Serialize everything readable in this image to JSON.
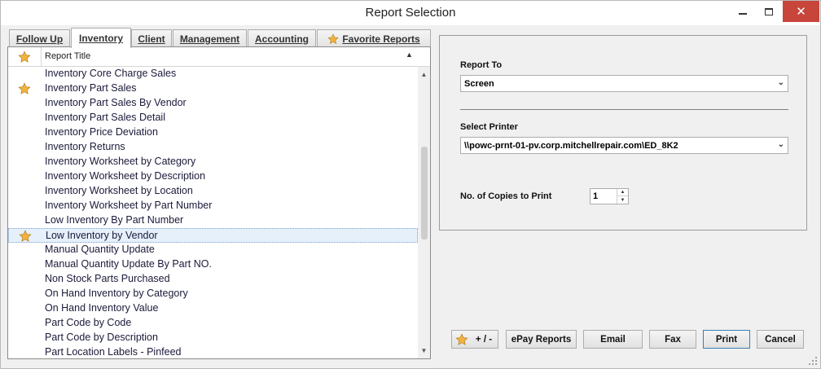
{
  "window": {
    "title": "Report Selection",
    "minimize_label": "",
    "maximize_label": "",
    "close_label": "✕"
  },
  "tabs": [
    {
      "label": "Follow Up"
    },
    {
      "label": "Inventory"
    },
    {
      "label": "Client"
    },
    {
      "label": "Management"
    },
    {
      "label": "Accounting"
    },
    {
      "label": "Favorite Reports",
      "icon": "star-icon"
    }
  ],
  "report_list": {
    "column_title": "Report Title",
    "sort": "ascending",
    "rows": [
      {
        "title": "Inventory Core Charge Sales",
        "favorite": false
      },
      {
        "title": "Inventory Part Sales",
        "favorite": true
      },
      {
        "title": "Inventory Part Sales By Vendor",
        "favorite": false
      },
      {
        "title": "Inventory Part Sales Detail",
        "favorite": false
      },
      {
        "title": "Inventory Price Deviation",
        "favorite": false
      },
      {
        "title": "Inventory Returns",
        "favorite": false
      },
      {
        "title": "Inventory Worksheet by Category",
        "favorite": false
      },
      {
        "title": "Inventory Worksheet by Description",
        "favorite": false
      },
      {
        "title": "Inventory Worksheet by Location",
        "favorite": false
      },
      {
        "title": "Inventory Worksheet by Part Number",
        "favorite": false
      },
      {
        "title": "Low Inventory By Part Number",
        "favorite": false
      },
      {
        "title": "Low Inventory by Vendor",
        "favorite": true,
        "selected": true
      },
      {
        "title": "Manual Quantity Update",
        "favorite": false
      },
      {
        "title": "Manual Quantity Update By Part NO.",
        "favorite": false
      },
      {
        "title": "Non Stock Parts Purchased",
        "favorite": false
      },
      {
        "title": "On Hand Inventory by Category",
        "favorite": false
      },
      {
        "title": "On Hand Inventory Value",
        "favorite": false
      },
      {
        "title": "Part Code by Code",
        "favorite": false
      },
      {
        "title": "Part Code by Description",
        "favorite": false
      },
      {
        "title": "Part Location Labels - Pinfeed",
        "favorite": false
      }
    ]
  },
  "settings": {
    "report_to_label": "Report To",
    "report_to_value": "Screen",
    "select_printer_label": "Select Printer",
    "select_printer_value": "\\\\powc-prnt-01-pv.corp.mitchellrepair.com\\ED_8K2",
    "copies_label": "No. of Copies to Print",
    "copies_value": "1"
  },
  "buttons": {
    "favorite_toggle": "+ / -",
    "epay": "ePay Reports",
    "email": "Email",
    "fax": "Fax",
    "print": "Print",
    "cancel": "Cancel"
  },
  "colors": {
    "star": "#f2b33d",
    "selection": "#e5f0fb",
    "close_button": "#c7453b"
  }
}
